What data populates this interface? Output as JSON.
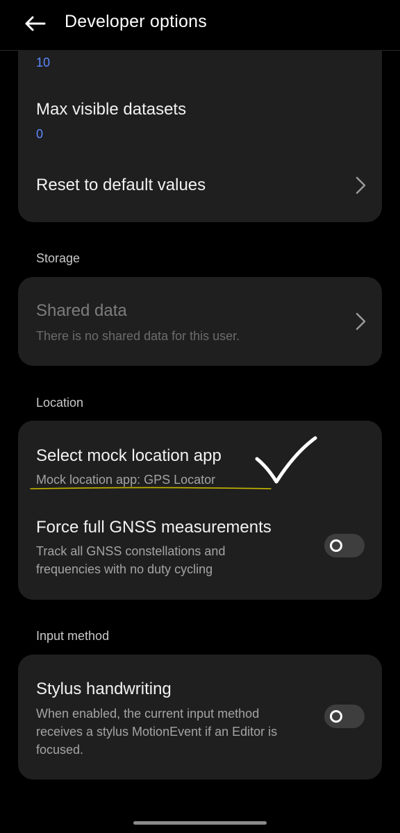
{
  "header": {
    "title": "Developer options"
  },
  "top_card": {
    "partial_value": "10",
    "max_visible_datasets": {
      "title": "Max visible datasets",
      "value": "0"
    },
    "reset": {
      "title": "Reset to default values"
    }
  },
  "storage": {
    "header": "Storage",
    "shared_data": {
      "title": "Shared data",
      "subtitle": "There is no shared data for this user."
    }
  },
  "location": {
    "header": "Location",
    "mock_location": {
      "title": "Select mock location app",
      "subtitle": "Mock location app: GPS Locator"
    },
    "gnss": {
      "title": "Force full GNSS measurements",
      "subtitle_line1": "Track all GNSS constellations and",
      "subtitle_line2": "frequencies with no duty cycling",
      "enabled": false
    }
  },
  "input_method": {
    "header": "Input method",
    "stylus": {
      "title": "Stylus handwriting",
      "subtitle_line1": "When enabled, the current input method",
      "subtitle_line2": "receives a stylus MotionEvent if an Editor is",
      "subtitle_line3": "focused.",
      "enabled": false
    }
  },
  "colors": {
    "background": "#000000",
    "card": "#1f1f1f",
    "accent_value": "#5e88ff",
    "annotation_check": "#ffffff",
    "annotation_underline": "#c9b800"
  },
  "icons": {
    "back": "arrow-left-icon",
    "chevron": "chevron-right-icon",
    "annotation": "checkmark-annotation"
  }
}
